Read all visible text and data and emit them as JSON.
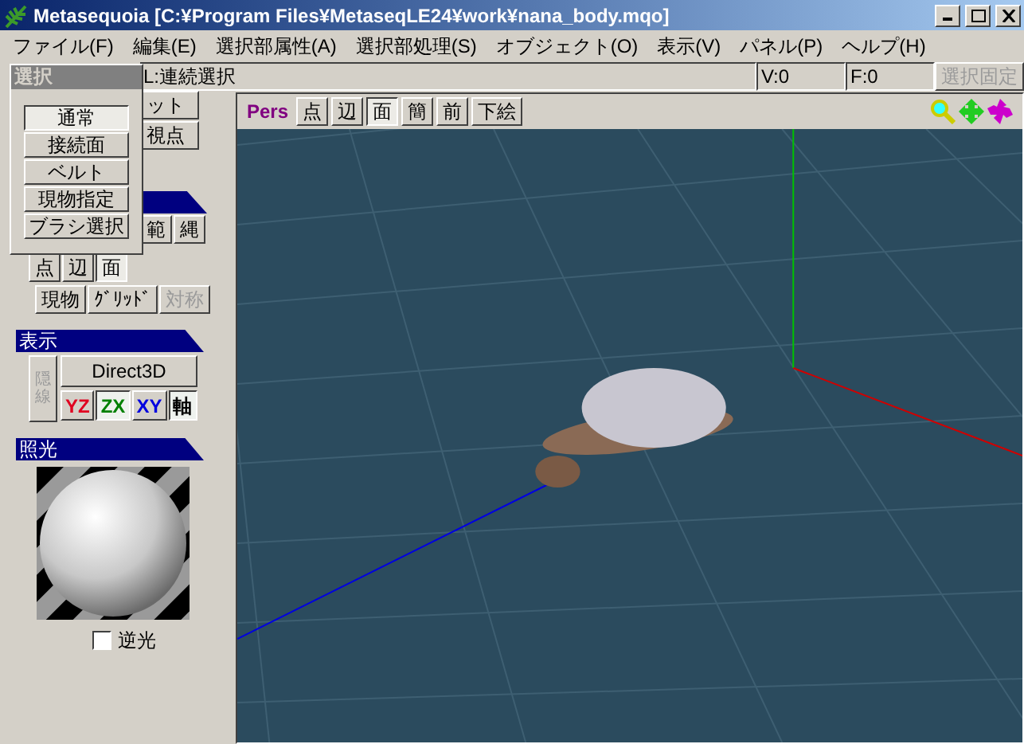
{
  "window": {
    "title": "Metasequoia [C:¥Program Files¥MetaseqLE24¥work¥nana_body.mqo]"
  },
  "menu": [
    "ファイル(F)",
    "編集(E)",
    "選択部属性(A)",
    "選択部処理(S)",
    "オブジェクト(O)",
    "表示(V)",
    "パネル(P)",
    "ヘルプ(H)"
  ],
  "status_bar": {
    "mode": "L:連続選択",
    "vertices": "V:0",
    "faces": "F:0",
    "lock_button": {
      "label": "選択固定",
      "disabled": true
    }
  },
  "select_popup": {
    "title": "選択",
    "items": [
      {
        "label": "通常",
        "selected": true
      },
      {
        "label": "接続面",
        "selected": false
      },
      {
        "label": "ベルト",
        "selected": false
      },
      {
        "label": "現物指定",
        "selected": false
      },
      {
        "label": "ブラシ選択",
        "selected": false
      }
    ]
  },
  "command_panel": {
    "row_1": [
      "ット",
      "視点"
    ],
    "row_2": [
      "範",
      "縄"
    ],
    "modes": [
      {
        "label": "点",
        "selected": false
      },
      {
        "label": "辺",
        "selected": false
      },
      {
        "label": "面",
        "selected": true
      }
    ],
    "options": [
      {
        "label": "現物",
        "disabled": false
      },
      {
        "label": "ｸﾞﾘｯﾄﾞ",
        "disabled": false
      },
      {
        "label": "対称",
        "disabled": true
      }
    ]
  },
  "display_panel": {
    "title": "表示",
    "vertical_button": {
      "label": "隠線",
      "disabled": true
    },
    "renderer": "Direct3D",
    "views": [
      {
        "label": "YZ",
        "color": "#e00020",
        "selected": false
      },
      {
        "label": "ZX",
        "color": "#008000",
        "selected": true
      },
      {
        "label": "XY",
        "color": "#0000e0",
        "selected": false
      },
      {
        "label": "軸",
        "color": "#000000",
        "selected": true
      }
    ]
  },
  "lighting_panel": {
    "title": "照光",
    "backlight": {
      "label": "逆光",
      "checked": false
    }
  },
  "viewport": {
    "projection": "Pers",
    "buttons": [
      {
        "label": "点",
        "selected": false
      },
      {
        "label": "辺",
        "selected": false
      },
      {
        "label": "面",
        "selected": true
      },
      {
        "label": "簡",
        "selected": false
      },
      {
        "label": "前",
        "selected": false
      },
      {
        "label": "下絵",
        "selected": false
      }
    ]
  }
}
